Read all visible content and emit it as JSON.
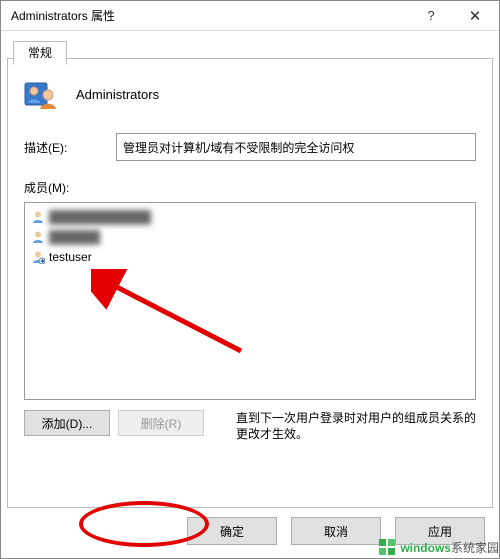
{
  "titlebar": {
    "title": "Administrators 属性"
  },
  "tab": {
    "label": "常规"
  },
  "group": {
    "name": "Administrators"
  },
  "description": {
    "label": "描述(E):",
    "value": "管理员对计算机/域有不受限制的完全访问权"
  },
  "members": {
    "label": "成员(M):",
    "items": [
      {
        "name": "████████████"
      },
      {
        "name": "██████"
      },
      {
        "name": "testuser"
      }
    ]
  },
  "actions": {
    "add": "添加(D)...",
    "remove": "删除(R)",
    "note": "直到下一次用户登录时对用户的组成员关系的更改才生效。"
  },
  "buttons": {
    "ok": "确定",
    "cancel": "取消",
    "apply": "应用"
  },
  "watermark": {
    "brand_prefix": "windows",
    "brand_suffix": "系统家园"
  }
}
